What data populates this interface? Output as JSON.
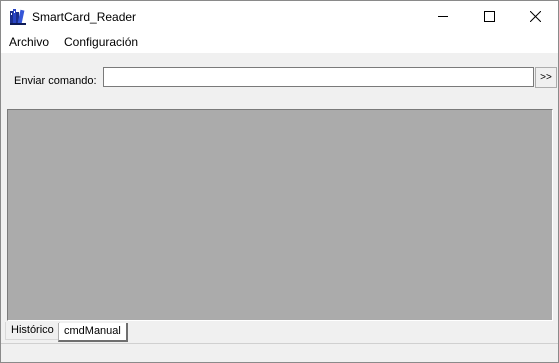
{
  "window": {
    "title": "SmartCard_Reader"
  },
  "icons": {
    "app": "books-icon",
    "minimize": "minimize-icon",
    "maximize": "maximize-icon",
    "close": "close-icon"
  },
  "menu": {
    "items": [
      {
        "label": "Archivo"
      },
      {
        "label": "Configuración"
      }
    ]
  },
  "command": {
    "label": "Enviar comando:",
    "value": "",
    "send_label": ">>"
  },
  "tabs": [
    {
      "label": "Histórico",
      "selected": false
    },
    {
      "label": "cmdManual",
      "selected": true
    }
  ],
  "colors": {
    "mdi_background": "#ababab",
    "window_background": "#f0f0f0"
  }
}
